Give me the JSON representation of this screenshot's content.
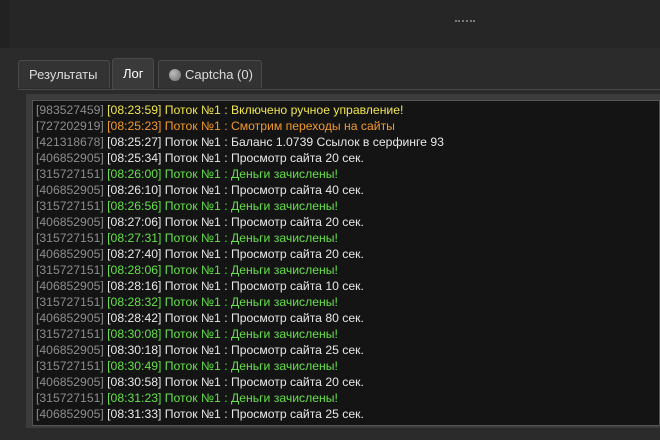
{
  "tabs": [
    {
      "label": "Результаты"
    },
    {
      "label": "Лог"
    },
    {
      "label": "Captcha (0)"
    }
  ],
  "colors": {
    "default": "#e8e8e8",
    "success": "#66e04a",
    "manual": "#f0e64e",
    "watch": "#f19a2c",
    "id": "#8c8c8c"
  },
  "log": [
    {
      "id": "[983527459]",
      "text": "[08:23:59] Поток №1 : Включено ручное управление!",
      "color": "yellow"
    },
    {
      "id": "[727202919]",
      "text": "[08:25:23] Поток №1 : Смотрим переходы на сайты",
      "color": "orange"
    },
    {
      "id": "[421318678]",
      "text": "[08:25:27] Поток №1 : Баланс 1.0739 Ссылок в серфинге 93",
      "color": "white"
    },
    {
      "id": "[406852905]",
      "text": "[08:25:34] Поток №1 : Просмотр сайта 20 сек.",
      "color": "white"
    },
    {
      "id": "[315727151]",
      "text": "[08:26:00] Поток №1 : Деньги зачислены!",
      "color": "green"
    },
    {
      "id": "[406852905]",
      "text": "[08:26:10] Поток №1 : Просмотр сайта 40 сек.",
      "color": "white"
    },
    {
      "id": "[315727151]",
      "text": "[08:26:56] Поток №1 : Деньги зачислены!",
      "color": "green"
    },
    {
      "id": "[406852905]",
      "text": "[08:27:06] Поток №1 : Просмотр сайта 20 сек.",
      "color": "white"
    },
    {
      "id": "[315727151]",
      "text": "[08:27:31] Поток №1 : Деньги зачислены!",
      "color": "green"
    },
    {
      "id": "[406852905]",
      "text": "[08:27:40] Поток №1 : Просмотр сайта 20 сек.",
      "color": "white"
    },
    {
      "id": "[315727151]",
      "text": "[08:28:06] Поток №1 : Деньги зачислены!",
      "color": "green"
    },
    {
      "id": "[406852905]",
      "text": "[08:28:16] Поток №1 : Просмотр сайта 10 сек.",
      "color": "white"
    },
    {
      "id": "[315727151]",
      "text": "[08:28:32] Поток №1 : Деньги зачислены!",
      "color": "green"
    },
    {
      "id": "[406852905]",
      "text": "[08:28:42] Поток №1 : Просмотр сайта 80 сек.",
      "color": "white"
    },
    {
      "id": "[315727151]",
      "text": "[08:30:08] Поток №1 : Деньги зачислены!",
      "color": "green"
    },
    {
      "id": "[406852905]",
      "text": "[08:30:18] Поток №1 : Просмотр сайта 25 сек.",
      "color": "white"
    },
    {
      "id": "[315727151]",
      "text": "[08:30:49] Поток №1 : Деньги зачислены!",
      "color": "green"
    },
    {
      "id": "[406852905]",
      "text": "[08:30:58] Поток №1 : Просмотр сайта 20 сек.",
      "color": "white"
    },
    {
      "id": "[315727151]",
      "text": "[08:31:23] Поток №1 : Деньги зачислены!",
      "color": "green"
    },
    {
      "id": "[406852905]",
      "text": "[08:31:33] Поток №1 : Просмотр сайта 25 сек.",
      "color": "white"
    }
  ]
}
